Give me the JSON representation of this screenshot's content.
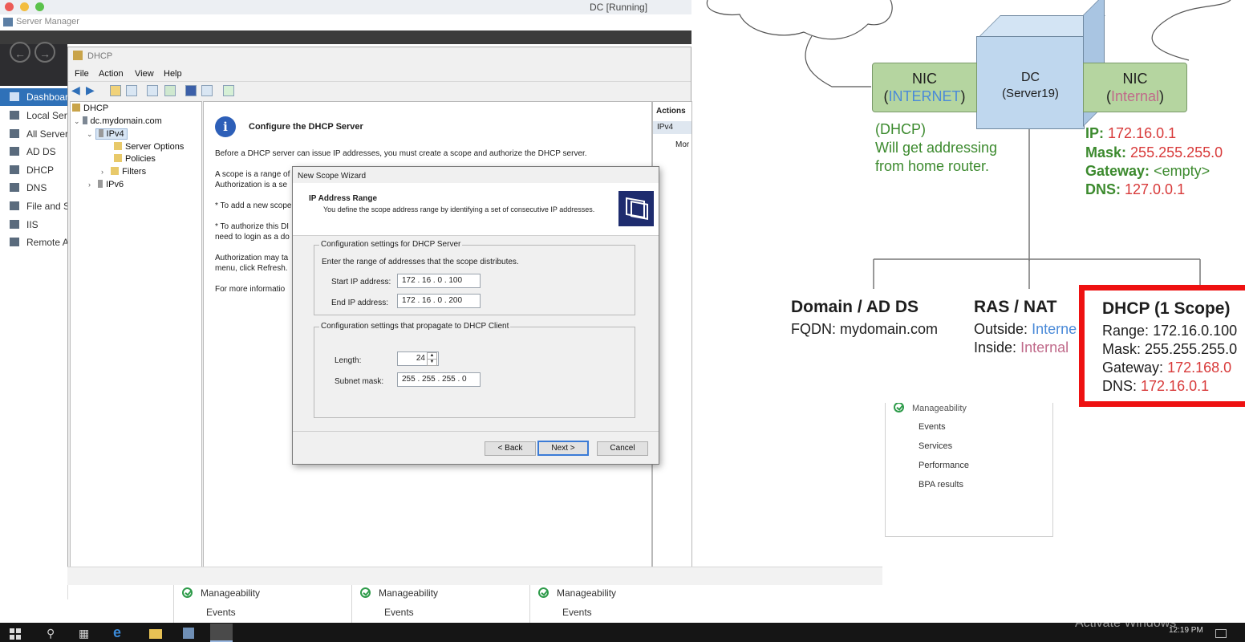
{
  "vm": {
    "title": "DC [Running]"
  },
  "server_manager": {
    "title": "Server Manager",
    "sidebar": [
      {
        "label": "Dashboard",
        "selected": true
      },
      {
        "label": "Local Server"
      },
      {
        "label": "All Servers"
      },
      {
        "label": "AD DS"
      },
      {
        "label": "DHCP"
      },
      {
        "label": "DNS"
      },
      {
        "label": "File and Storage"
      },
      {
        "label": "IIS"
      },
      {
        "label": "Remote Access"
      }
    ],
    "tiles": [
      {
        "row1": "Manageability",
        "row2": "Events"
      },
      {
        "row1": "Manageability",
        "row2": "Events"
      },
      {
        "row1": "Manageability",
        "row2": "Events"
      }
    ],
    "right_tile": {
      "row0": "Manageability",
      "rows": [
        "Events",
        "Services",
        "Performance",
        "BPA results"
      ]
    }
  },
  "dhcp": {
    "title": "DHCP",
    "menu": [
      "File",
      "Action",
      "View",
      "Help"
    ],
    "tree": {
      "root": "DHCP",
      "server": "dc.mydomain.com",
      "ipv4": "IPv4",
      "server_options": "Server Options",
      "policies": "Policies",
      "filters": "Filters",
      "ipv6": "IPv6"
    },
    "center": {
      "heading": "Configure the DHCP Server",
      "p1": "Before a DHCP server can issue IP addresses, you must create a scope and authorize the DHCP server.",
      "p2a": "A scope is a range of",
      "p2b": "Authorization is a se",
      "p3": "* To add a new scope",
      "p4a": "* To authorize this DI",
      "p4b": "need to login as a do",
      "p5a": "Authorization may ta",
      "p5b": "menu, click Refresh.",
      "p6": "For more informatio"
    },
    "actions": {
      "title": "Actions",
      "item": "IPv4",
      "more": "Mor"
    }
  },
  "wizard": {
    "title": "New Scope Wizard",
    "heading": "IP Address Range",
    "subheading": "You define the scope address range by identifying a set of consecutive IP addresses.",
    "group1": "Configuration settings for DHCP Server",
    "group1_desc": "Enter the range of addresses that the scope distributes.",
    "start_label": "Start IP address:",
    "start_value": "172 . 16 . 0 . 100",
    "end_label": "End IP address:",
    "end_value": "172 . 16 . 0 . 200",
    "group2": "Configuration settings that propagate to DHCP Client",
    "length_label": "Length:",
    "length_value": "24",
    "mask_label": "Subnet mask:",
    "mask_value": "255 . 255 . 255 . 0",
    "back": "< Back",
    "next": "Next >",
    "cancel": "Cancel"
  },
  "taskbar": {
    "time": "12:19 PM",
    "watermark": "Activate Windows"
  },
  "diagram": {
    "nic_left": {
      "title": "NIC",
      "sub": "INTERNET"
    },
    "dc": {
      "title": "DC",
      "sub": "(Server19)"
    },
    "nic_right": {
      "title": "NIC",
      "sub": "Internal"
    },
    "dhcp_note": [
      "(DHCP)",
      "Will get addressing",
      "from home router."
    ],
    "ip_label": "IP:",
    "ip_value": "172.16.0.1",
    "mask_label": "Mask:",
    "mask_value": "255.255.255.0",
    "gw_label": "Gateway:",
    "gw_value": "<empty>",
    "dns_label": "DNS:",
    "dns_value": "127.0.0.1",
    "adds": {
      "title": "Domain / AD DS",
      "fqdn_label": "FQDN:",
      "fqdn_value": "mydomain.com"
    },
    "ras": {
      "title": "RAS / NAT",
      "outside_label": "Outside:",
      "outside_value": "Interne",
      "inside_label": "Inside:",
      "inside_value": "Internal"
    },
    "dhcp_scope": {
      "title": "DHCP (1 Scope)",
      "range_label": "Range:",
      "range_value": "172.16.0.100",
      "mask_label": "Mask:",
      "mask_value": "255.255.255.0",
      "gw_label": "Gateway:",
      "gw_value": "172.168.0",
      "dns_label": "DNS:",
      "dns_value": "172.16.0.1"
    },
    "colors": {
      "green": "#3c8a2e",
      "red": "#d83a3a",
      "highlight": "#ee1111"
    }
  }
}
